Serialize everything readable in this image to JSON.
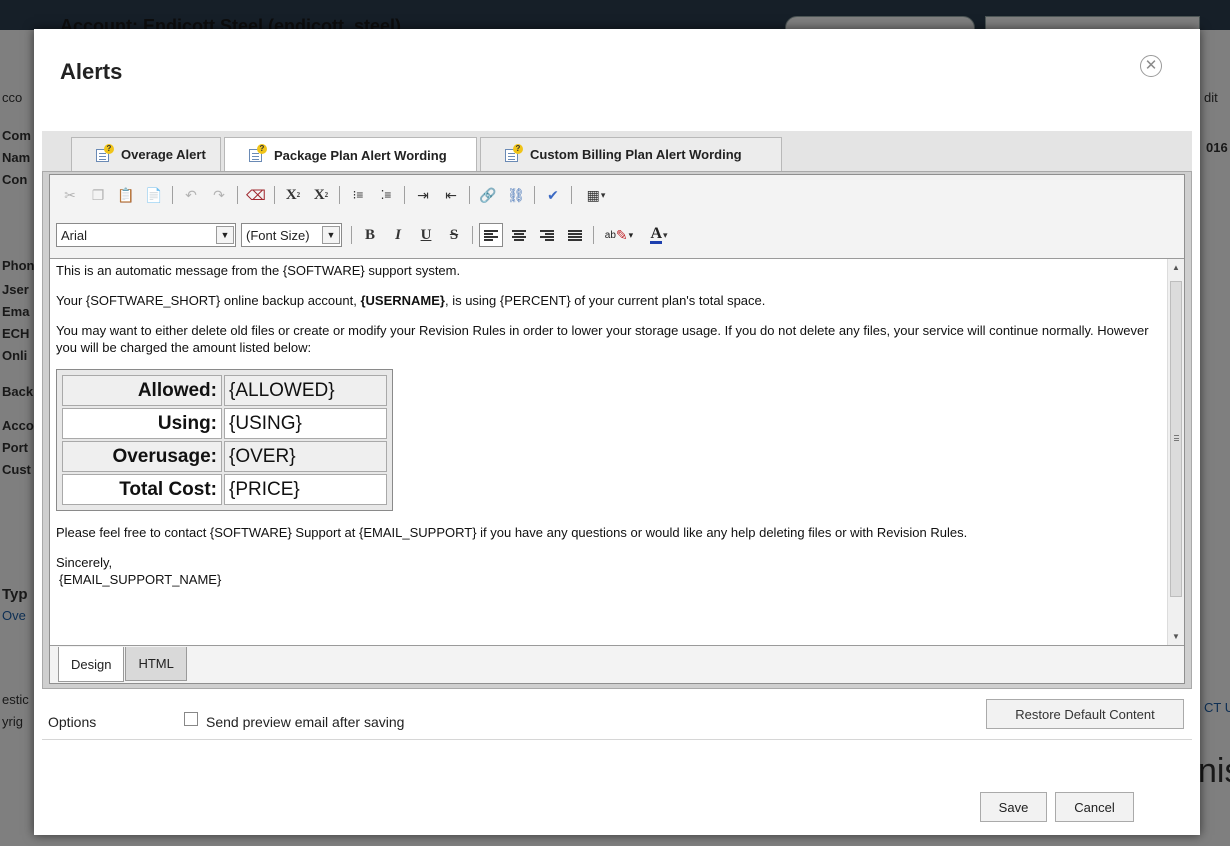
{
  "background": {
    "account_title": "Account: Endicott Steel (endicott_steel)",
    "edit_label": "dit",
    "year_label": "016",
    "left_labels": [
      "cco",
      "Com",
      "Nam",
      "Con",
      "Phon",
      "Jser",
      "Ema",
      "ECH",
      "Onli",
      "Back",
      "Acco",
      "Port",
      "Cust",
      "Typ",
      "Ove",
      "estic",
      "yrig"
    ],
    "right_link": "CT U",
    "logo_text": "nis"
  },
  "modal": {
    "title": "Alerts",
    "close_icon": "close-circle-icon"
  },
  "tabs": [
    {
      "label": "Overage Alert",
      "active": false
    },
    {
      "label": "Package Plan Alert Wording",
      "active": true
    },
    {
      "label": "Custom Billing Plan Alert Wording",
      "active": false
    }
  ],
  "toolbar": {
    "font_name": "Arial",
    "font_size": "(Font Size)",
    "superscript": "X",
    "subscript": "X",
    "bold": "B",
    "italic": "I",
    "underline": "U",
    "strike": "S",
    "highlight": "ab",
    "font_color": "A"
  },
  "content": {
    "line1": "This is an automatic message from the {SOFTWARE} support system.",
    "line2_pre": "Your {SOFTWARE_SHORT} online backup account, ",
    "line2_bold": "{USERNAME}",
    "line2_post": ", is using {PERCENT} of your current plan's total space.",
    "line3": "You may want to either delete old files or create or modify your Revision Rules in order to lower your storage usage. If you do not delete any files, your service will continue normally. However you will be charged the amount listed below:",
    "table": [
      {
        "label": "Allowed:",
        "value": "{ALLOWED}"
      },
      {
        "label": "Using:",
        "value": "{USING}"
      },
      {
        "label": "Overusage:",
        "value": "{OVER}"
      },
      {
        "label": "Total Cost:",
        "value": "{PRICE}"
      }
    ],
    "line4": "Please feel free to contact {SOFTWARE} Support at {EMAIL_SUPPORT} if you have any questions or would like any help deleting files or with Revision Rules.",
    "line5": "Sincerely,",
    "line6": "{EMAIL_SUPPORT_NAME}"
  },
  "mode_tabs": [
    {
      "label": "Design",
      "active": true
    },
    {
      "label": "HTML",
      "active": false
    }
  ],
  "options": {
    "label": "Options",
    "preview_checkbox_label": "Send preview email after saving",
    "preview_checked": false,
    "restore_button": "Restore Default Content"
  },
  "footer": {
    "save": "Save",
    "cancel": "Cancel"
  },
  "colors": {
    "topbar": "#2d3e50",
    "font_color_bar": "#1d3fae",
    "overlay": "rgba(0,0,0,0.5)"
  }
}
